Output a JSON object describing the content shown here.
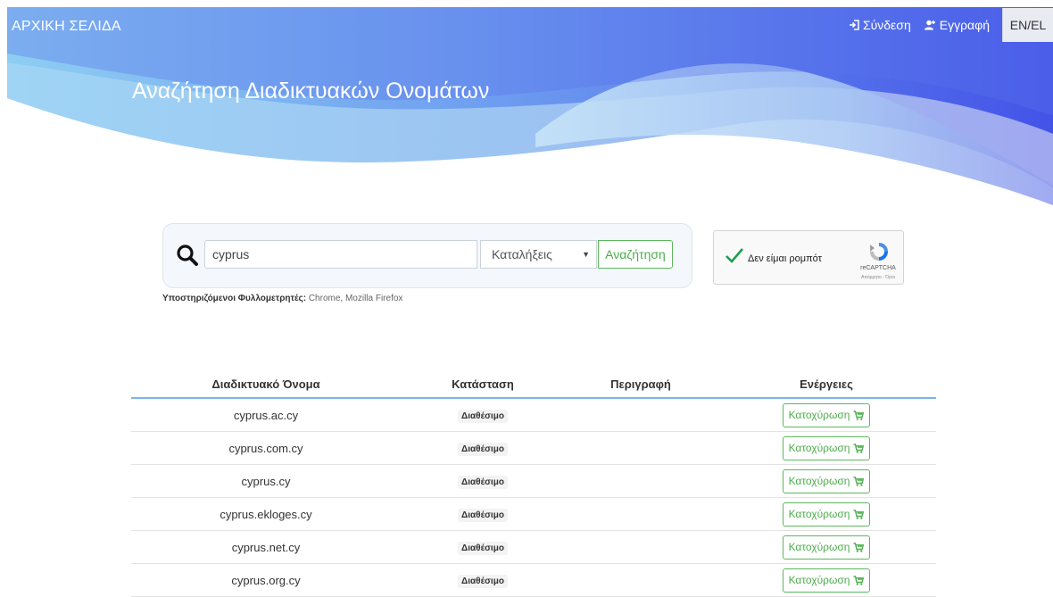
{
  "nav": {
    "brand": "ΑΡΧΙΚΗ ΣΕΛΙΔΑ",
    "login": "Σύνδεση",
    "register": "Εγγραφή",
    "language": "EN/EL"
  },
  "hero": {
    "title": "Αναζήτηση Διαδικτυακών Ονομάτων"
  },
  "search": {
    "query": "cyprus",
    "extension_select": "Καταλήξεις",
    "button": "Αναζήτηση",
    "browsers_label": "Υποστηριζόμενοι Φυλλομετρητές:",
    "browsers_value": "Chrome, Mozilla Firefox"
  },
  "captcha": {
    "label": "Δεν είμαι ρομπότ",
    "brand": "reCAPTCHA",
    "terms": "Απόρρητο - Όροι"
  },
  "table": {
    "headers": [
      "Διαδικτυακό Όνομα",
      "Κατάσταση",
      "Περιγραφή",
      "Ενέργειες"
    ],
    "rows": [
      {
        "domain": "cyprus.ac.cy",
        "status": "Διαθέσιμο",
        "description": "",
        "action": "Κατοχύρωση"
      },
      {
        "domain": "cyprus.com.cy",
        "status": "Διαθέσιμο",
        "description": "",
        "action": "Κατοχύρωση"
      },
      {
        "domain": "cyprus.cy",
        "status": "Διαθέσιμο",
        "description": "",
        "action": "Κατοχύρωση"
      },
      {
        "domain": "cyprus.ekloges.cy",
        "status": "Διαθέσιμο",
        "description": "",
        "action": "Κατοχύρωση"
      },
      {
        "domain": "cyprus.net.cy",
        "status": "Διαθέσιμο",
        "description": "",
        "action": "Κατοχύρωση"
      },
      {
        "domain": "cyprus.org.cy",
        "status": "Διαθέσιμο",
        "description": "",
        "action": "Κατοχύρωση"
      }
    ]
  },
  "colors": {
    "hero_light": "#8cc6ef",
    "hero_dark": "#4a5fe6",
    "success": "#5cb85c",
    "table_border": "#79b6e6"
  }
}
